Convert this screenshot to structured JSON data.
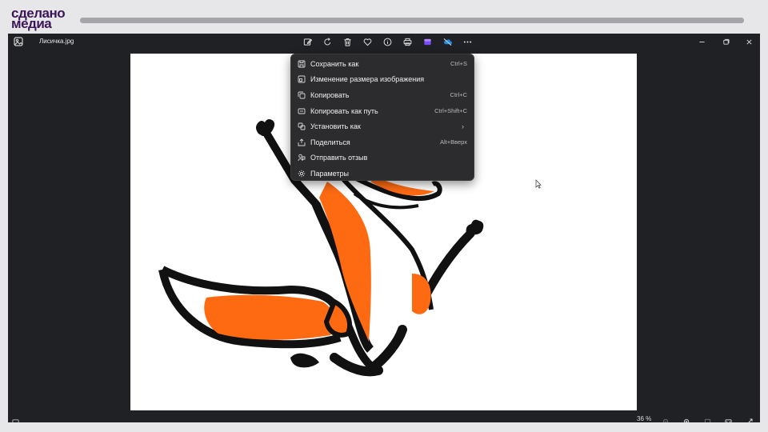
{
  "brand": {
    "line1": "сделано",
    "line2": "медиа",
    "color": "#3b1557"
  },
  "video_progress": {
    "fraction": 1.0
  },
  "window": {
    "file_name": "Лисичка.jpg",
    "toolbar_icons": [
      "edit-image-icon",
      "rotate-icon",
      "delete-icon",
      "favorite-icon",
      "info-icon",
      "print-icon",
      "clipchamp-icon",
      "onedrive-icon",
      "more-icon"
    ],
    "window_controls": [
      "minimize-icon",
      "maximize-icon",
      "close-icon"
    ]
  },
  "context_menu": {
    "items": [
      {
        "label": "Сохранить как",
        "shortcut": "Ctrl+S",
        "icon": "save-icon"
      },
      {
        "label": "Изменение размера изображения",
        "shortcut": "",
        "icon": "resize-icon"
      },
      {
        "label": "Копировать",
        "shortcut": "Ctrl+C",
        "icon": "copy-icon"
      },
      {
        "label": "Копировать как путь",
        "shortcut": "Ctrl+Shift+C",
        "icon": "copy-path-icon"
      },
      {
        "label": "Установить как",
        "shortcut": "",
        "icon": "set-as-icon",
        "submenu": true
      },
      {
        "label": "Поделиться",
        "shortcut": "Alt+Вверх",
        "icon": "share-icon"
      },
      {
        "label": "Отправить отзыв",
        "shortcut": "",
        "icon": "feedback-icon"
      },
      {
        "label": "Параметры",
        "shortcut": "",
        "icon": "settings-icon"
      }
    ]
  },
  "status": {
    "zoom": "36 %"
  },
  "colors": {
    "window_bg": "#202124",
    "menu_bg": "#2c2c2e",
    "fox_orange": "#fd6a12"
  }
}
